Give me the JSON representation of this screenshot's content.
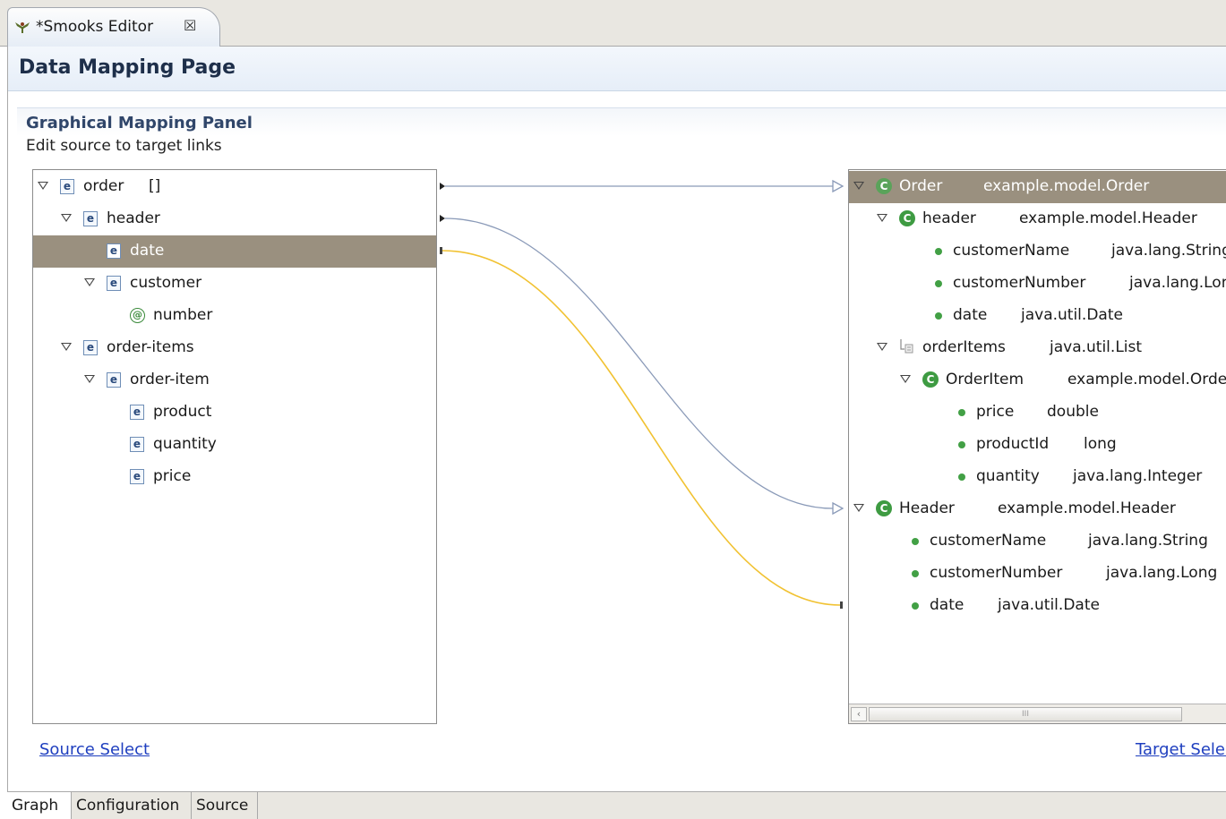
{
  "editor_tab": {
    "label": "*Smooks Editor",
    "close": "☒"
  },
  "page": {
    "title": "Data Mapping Page"
  },
  "section": {
    "title": "Graphical Mapping Panel",
    "description": "Edit source to target links"
  },
  "source_tree": [
    {
      "label": "order",
      "suffix": "[]",
      "icon": "element-icon"
    },
    {
      "label": "header",
      "icon": "element-icon"
    },
    {
      "label": "date",
      "icon": "element-icon",
      "selected": true
    },
    {
      "label": "customer",
      "icon": "element-icon"
    },
    {
      "label": "number",
      "icon": "attribute-icon",
      "glyph": "@"
    },
    {
      "label": "order-items",
      "icon": "element-icon"
    },
    {
      "label": "order-item",
      "icon": "element-icon"
    },
    {
      "label": "product",
      "icon": "element-icon"
    },
    {
      "label": "quantity",
      "icon": "element-icon"
    },
    {
      "label": "price",
      "icon": "element-icon"
    }
  ],
  "element_glyph": "e",
  "class_glyph": "C",
  "target_tree": [
    {
      "label": "Order",
      "type": "example.model.Order",
      "icon": "class-icon",
      "selected": true
    },
    {
      "label": "header",
      "type": "example.model.Header",
      "icon": "class-icon"
    },
    {
      "label": "customerName",
      "type": "java.lang.String",
      "icon": "field-icon"
    },
    {
      "label": "customerNumber",
      "type": "java.lang.Long",
      "icon": "field-icon"
    },
    {
      "label": "date",
      "type": "java.util.Date",
      "icon": "field-icon"
    },
    {
      "label": "orderItems",
      "type": "java.util.List",
      "icon": "list-icon"
    },
    {
      "label": "OrderItem",
      "type": "example.model.OrderItem",
      "icon": "class-icon"
    },
    {
      "label": "price",
      "type": "double",
      "icon": "field-icon"
    },
    {
      "label": "productId",
      "type": "long",
      "icon": "field-icon"
    },
    {
      "label": "quantity",
      "type": "java.lang.Integer",
      "icon": "field-icon"
    },
    {
      "label": "Header",
      "type": "example.model.Header",
      "icon": "class-icon"
    },
    {
      "label": "customerName",
      "type": "java.lang.String",
      "icon": "field-icon"
    },
    {
      "label": "customerNumber",
      "type": "java.lang.Long",
      "icon": "field-icon"
    },
    {
      "label": "date",
      "type": "java.util.Date",
      "icon": "field-icon"
    }
  ],
  "scrollbar": {
    "left_arrow": "‹",
    "grip": "III"
  },
  "links": {
    "source_select": "Source Select",
    "target_select": "Target Select"
  },
  "bottom_tabs": [
    {
      "label": "Graph",
      "active": true
    },
    {
      "label": "Configuration"
    },
    {
      "label": "Source"
    }
  ],
  "colors": {
    "selected_row": "#9a907f",
    "link_line": "#8a9ab8",
    "selected_link_line": "#f1c232",
    "hyperlink": "#1f3fbf"
  }
}
